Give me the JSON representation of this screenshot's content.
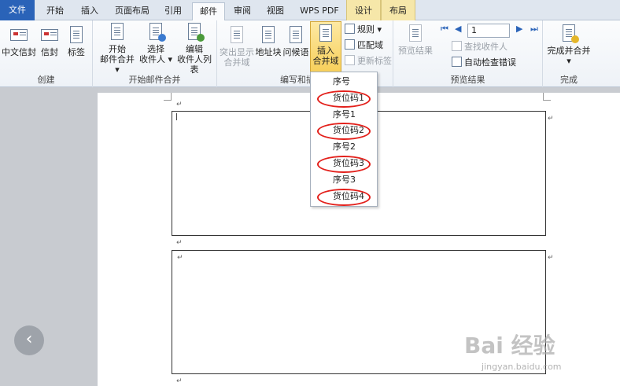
{
  "tabs": [
    "文件",
    "开始",
    "插入",
    "页面布局",
    "引用",
    "邮件",
    "审阅",
    "视图",
    "WPS PDF",
    "设计",
    "布局"
  ],
  "ribbon": {
    "create": {
      "label": "创建",
      "chinese_envelope": "中文信封",
      "envelope": "信封",
      "labels": "标签"
    },
    "start_merge": {
      "label": "开始邮件合并",
      "start_line1": "开始",
      "start_line2": "邮件合并 ▾",
      "select_line1": "选择",
      "select_line2": "收件人 ▾",
      "edit_line1": "编辑",
      "edit_line2": "收件人列表"
    },
    "write_insert": {
      "label": "编写和插",
      "highlight_line1": "突出显示",
      "highlight_line2": "合并域",
      "address_block": "地址块",
      "greeting_line": "问候语",
      "insert_line1": "插入",
      "insert_line2": "合并域",
      "rules": "规则 ▾",
      "match_fields": "匹配域",
      "update_labels": "更新标签"
    },
    "preview": {
      "label": "预览结果",
      "preview_results": "预览结果",
      "page_value": "1",
      "find_recipient": "查找收件人",
      "auto_check": "自动检查错误"
    },
    "finish": {
      "label": "完成",
      "finish_merge": "完成并合并",
      "finish_arrow": "▾"
    }
  },
  "dropdown_items": [
    "序号",
    "货位码1",
    "序号1",
    "货位码2",
    "序号2",
    "货位码3",
    "序号3",
    "货位码4"
  ],
  "paragraph_mark": "↵",
  "back_button": "‹",
  "watermark": "Bai 经验",
  "watermark_sub": "jingyan.baidu.com",
  "colors": {
    "accent": "#2a63b8",
    "highlight_ring": "#e3201b",
    "context_tab": "#f6e7a9"
  }
}
